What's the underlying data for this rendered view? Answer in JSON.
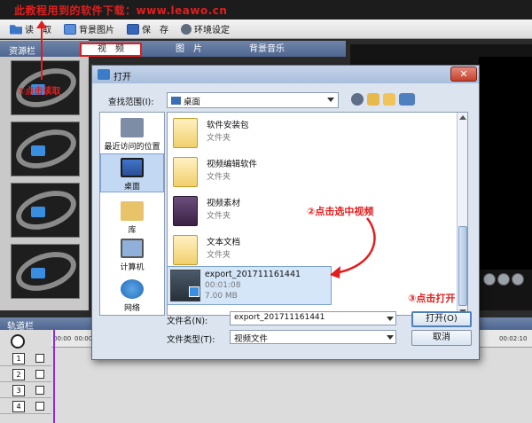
{
  "banner": "此教程用到的软件下载：www.leawo.cn",
  "toolbar": {
    "read": "读　取",
    "bg_image": "背景图片",
    "save": "保　存",
    "settings": "环境设定"
  },
  "panel": {
    "title": "资源栏",
    "tabs": [
      "视　频",
      "图　片",
      "背景音乐"
    ]
  },
  "annotations": {
    "step1": "①点击读取",
    "step2": "②点击选中视频",
    "step3": "③点击打开"
  },
  "timeline": {
    "title": "轨道栏",
    "ruler": [
      "00:00",
      "00:00:10",
      "00:02:10"
    ],
    "tracks": [
      "1",
      "2",
      "3",
      "4"
    ]
  },
  "dialog": {
    "title": "打开",
    "look_in_label": "查找范围(I):",
    "look_in_value": "桌面",
    "places": [
      "最近访问的位置",
      "桌面",
      "库",
      "计算机",
      "网络"
    ],
    "files": [
      {
        "name": "软件安装包",
        "type": "文件夹"
      },
      {
        "name": "视频编辑软件",
        "type": "文件夹"
      },
      {
        "name": "视频素材",
        "type": "文件夹"
      },
      {
        "name": "文本文档",
        "type": "文件夹"
      }
    ],
    "video": {
      "name": "export_201711161441",
      "duration": "00:01:08",
      "size": "7.00 MB"
    },
    "file_name_label": "文件名(N):",
    "file_name_value": "export_201711161441",
    "file_type_label": "文件类型(T):",
    "file_type_value": "视频文件",
    "open_button": "打开(O)",
    "cancel_button": "取消"
  },
  "colors": {
    "annotation": "#e31d1d",
    "title_gradient_top": "#c5d4ea",
    "selection": "#d5e6f8"
  }
}
